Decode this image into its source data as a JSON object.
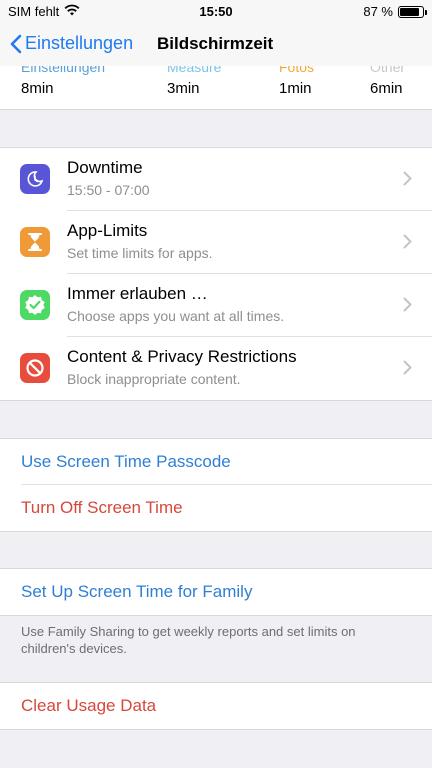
{
  "status": {
    "carrier": "SIM fehlt",
    "time": "15:50",
    "battery": "87 %",
    "battery_level": 0.87
  },
  "nav": {
    "back_label": "Einstellungen",
    "title": "Bildschirmzeit"
  },
  "usage": [
    {
      "category": "Einstellungen",
      "value": "8min",
      "color": "#5aa0d8"
    },
    {
      "category": "Measure",
      "value": "3min",
      "color": "#7ec3e6"
    },
    {
      "category": "Fotos",
      "value": "1min",
      "color": "#f2a93b"
    },
    {
      "category": "Other",
      "value": "6min",
      "color": "#c7c7cc"
    }
  ],
  "settings": [
    {
      "title": "Downtime",
      "subtitle": "15:50 - 07:00",
      "icon": "moon-clock-icon",
      "color": "#5856d6"
    },
    {
      "title": "App-Limits",
      "subtitle": "Set time limits for apps.",
      "icon": "hourglass-icon",
      "color": "#f09a37"
    },
    {
      "title": "Immer erlauben …",
      "subtitle": "Choose apps you want at all times.",
      "icon": "check-badge-icon",
      "color": "#4cd964"
    },
    {
      "title": "Content & Privacy Restrictions",
      "subtitle": "Block inappropriate content.",
      "icon": "no-entry-icon",
      "color": "#e84c3d"
    }
  ],
  "passcode": {
    "use_passcode": "Use Screen Time Passcode",
    "turn_off": "Turn Off Screen Time"
  },
  "family": {
    "setup": "Set Up Screen Time for Family",
    "footnote": "Use Family Sharing to get weekly reports and set limits on children's devices."
  },
  "clear": {
    "label": "Clear Usage Data"
  }
}
